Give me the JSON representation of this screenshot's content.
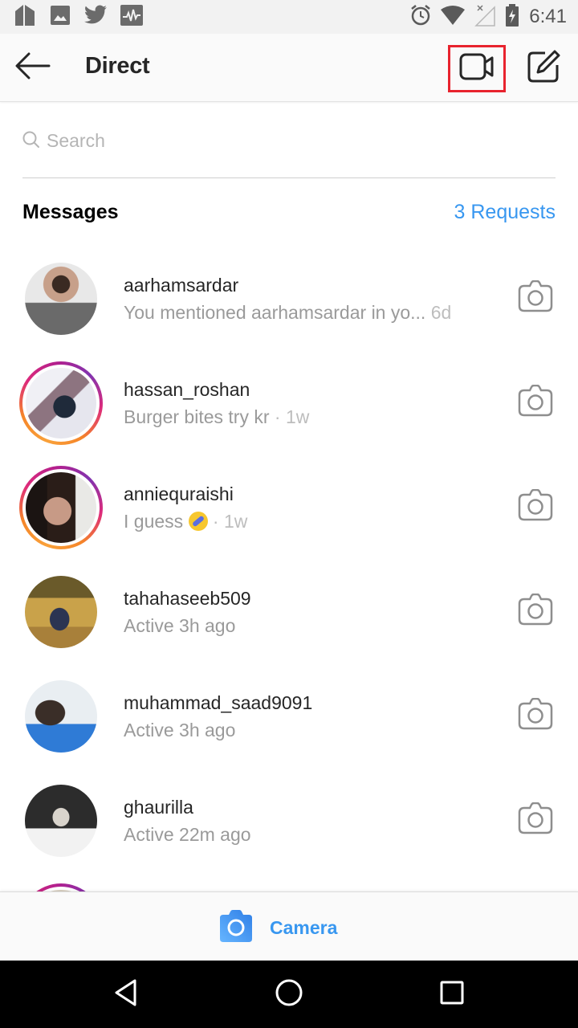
{
  "status_bar": {
    "left_icons": [
      "app-notification-icon",
      "image-icon",
      "twitter-icon",
      "activity-icon"
    ],
    "right_icons": [
      "alarm-icon",
      "wifi-icon",
      "no-signal-icon",
      "battery-charging-icon"
    ],
    "time": "6:41"
  },
  "header": {
    "title": "Direct",
    "back_icon": "arrow-left-icon",
    "video_icon": "video-camera-icon",
    "compose_icon": "compose-icon",
    "highlight_color": "#e8232e"
  },
  "search": {
    "placeholder": "Search",
    "value": ""
  },
  "messages_section": {
    "title": "Messages",
    "requests_label": "3 Requests",
    "accent_color": "#3897f0"
  },
  "conversations": [
    {
      "username": "aarhamsardar",
      "preview": "You mentioned aarhamsardar in yo...",
      "time": "6d",
      "separator": " ",
      "story_ring": false
    },
    {
      "username": "hassan_roshan",
      "preview": "Burger bites try kr",
      "time": "1w",
      "separator": " · ",
      "story_ring": true
    },
    {
      "username": "anniequraishi",
      "preview": "I guess",
      "emoji": "rolling-on-floor-laughing",
      "time": "1w",
      "separator": " · ",
      "story_ring": true
    },
    {
      "username": "tahahaseeb509",
      "preview": "Active 3h ago",
      "time": "",
      "separator": "",
      "story_ring": false
    },
    {
      "username": "muhammad_saad9091",
      "preview": "Active 3h ago",
      "time": "",
      "separator": "",
      "story_ring": false
    },
    {
      "username": "ghaurilla",
      "preview": "Active 22m ago",
      "time": "",
      "separator": "",
      "story_ring": false
    }
  ],
  "bottom_bar": {
    "camera_label": "Camera"
  },
  "nav_bar": {
    "buttons": [
      "back",
      "home",
      "recents"
    ]
  }
}
